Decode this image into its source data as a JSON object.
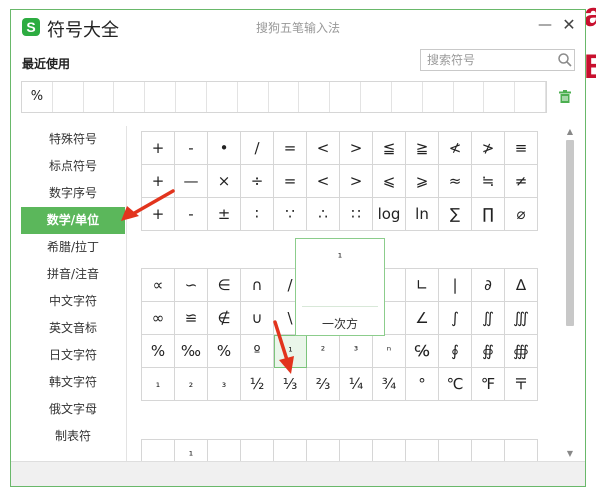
{
  "window": {
    "app_title": "符号大全",
    "ime_title": "搜狗五笔输入法",
    "minimize": "—",
    "close": "✕",
    "logo": "S"
  },
  "background": {
    "text_top": "a",
    "text_mid": "B"
  },
  "recent": {
    "label": "最近使用",
    "items": [
      "%",
      "",
      "",
      "",
      "",
      "",
      "",
      "",
      "",
      "",
      "",
      "",
      "",
      "",
      "",
      "",
      ""
    ]
  },
  "search": {
    "placeholder": "搜索符号"
  },
  "categories": [
    {
      "label": "特殊符号",
      "active": false
    },
    {
      "label": "标点符号",
      "active": false
    },
    {
      "label": "数字序号",
      "active": false
    },
    {
      "label": "数学/单位",
      "active": true
    },
    {
      "label": "希腊/拉丁",
      "active": false
    },
    {
      "label": "拼音/注音",
      "active": false
    },
    {
      "label": "中文字符",
      "active": false
    },
    {
      "label": "英文音标",
      "active": false
    },
    {
      "label": "日文字符",
      "active": false
    },
    {
      "label": "韩文字符",
      "active": false
    },
    {
      "label": "俄文字母",
      "active": false
    },
    {
      "label": "制表符",
      "active": false
    }
  ],
  "grid_top": [
    [
      "+",
      "-",
      "•",
      "∕",
      "=",
      "<",
      ">",
      "≦",
      "≧",
      "≮",
      "≯",
      "≡"
    ],
    [
      "+",
      "—",
      "×",
      "÷",
      "=",
      "<",
      ">",
      "⩽",
      "⩾",
      "≈",
      "≒",
      "≠"
    ],
    [
      "+",
      "-",
      "±",
      "∶",
      "∵",
      "∴",
      "∷",
      "log",
      "ln",
      "∑",
      "∏",
      "⌀"
    ]
  ],
  "grid_bottom": [
    [
      "∝",
      "∽",
      "∈",
      "∩",
      "/",
      "",
      "",
      "",
      "//",
      "∟",
      "|",
      "∂",
      "∆"
    ],
    [
      "∞",
      "≌",
      "∉",
      "∪",
      "\\",
      "",
      "",
      "",
      "⊥",
      "∠",
      "∫",
      "∬",
      "∭"
    ],
    [
      "%",
      "‰",
      "%",
      "º",
      "¹",
      "²",
      "³",
      "ⁿ",
      "℅",
      "∮",
      "∯",
      "∰"
    ],
    [
      "₁",
      "₂",
      "₃",
      "½",
      "⅓",
      "⅔",
      "¼",
      "¾",
      "°",
      "℃",
      "℉",
      "〒"
    ]
  ],
  "grid_partial": [
    "",
    "¹",
    "",
    "",
    "",
    "",
    "",
    "",
    "",
    "",
    "",
    ""
  ],
  "tooltip": {
    "symbol": "¹",
    "name": "一次方"
  },
  "colors": {
    "accent": "#5bb75b",
    "arrow": "#e2341d",
    "border": "#69b86a"
  }
}
